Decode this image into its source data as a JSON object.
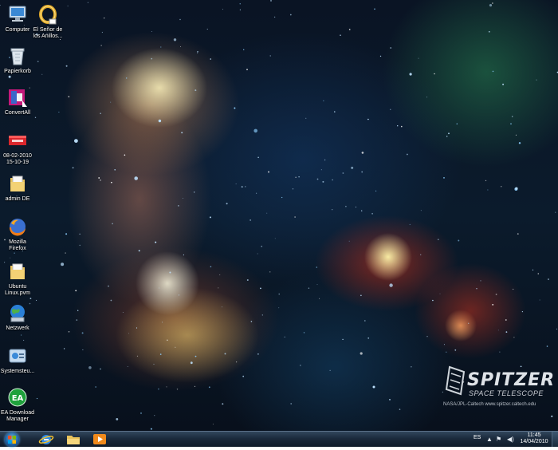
{
  "desktop": {
    "icons": [
      {
        "name": "computer",
        "label": "Computer",
        "icon": "computer-icon"
      },
      {
        "name": "lotr",
        "label": "El Señor de\nlos Anillos...",
        "icon": "ring-icon"
      },
      {
        "name": "recycle-bin",
        "label": "Papierkorb",
        "icon": "recycle-bin-icon"
      },
      {
        "name": "convertall",
        "label": "ConvertAll",
        "icon": "convertall-icon"
      },
      {
        "name": "datefile",
        "label": "08-02-2010\n15-10-19",
        "icon": "ticket-icon"
      },
      {
        "name": "admin-de",
        "label": "admin DE",
        "icon": "folder-icon"
      },
      {
        "name": "firefox",
        "label": "Mozilla\nFirefox",
        "icon": "firefox-icon"
      },
      {
        "name": "ubuntu-pvm",
        "label": "Ubuntu\nLinux.pvm",
        "icon": "folder-icon"
      },
      {
        "name": "network",
        "label": "Netzwerk",
        "icon": "network-icon"
      },
      {
        "name": "control-panel",
        "label": "Systemsteu...",
        "icon": "control-panel-icon"
      },
      {
        "name": "ea-download",
        "label": "EA Download\nManager",
        "icon": "ea-icon"
      }
    ]
  },
  "wallpaper": {
    "brand": "SPITZER",
    "subtitle": "SPACE TELESCOPE",
    "credit": "NASA/JPL-Caltech    www.spitzer.caltech.edu"
  },
  "taskbar": {
    "pinned": [
      {
        "name": "internet-explorer",
        "icon": "ie-icon"
      },
      {
        "name": "explorer",
        "icon": "folder-icon"
      },
      {
        "name": "media-player",
        "icon": "media-player-icon"
      }
    ],
    "language": "ES",
    "time": "11:45",
    "date": "14/04/2010"
  },
  "colors": {
    "taskbar": "#1b2a3c",
    "start_orb": "#1f5f9d"
  }
}
